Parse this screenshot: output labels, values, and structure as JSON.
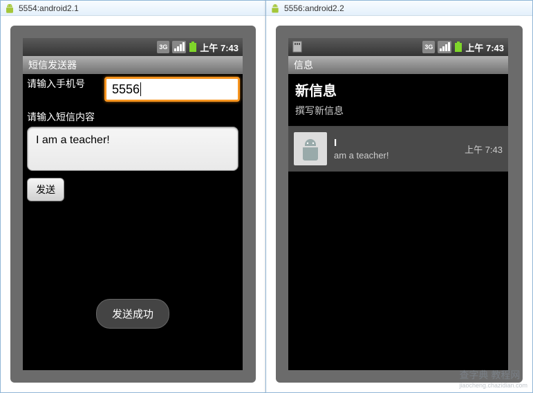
{
  "windows": {
    "left": {
      "title": "5554:android2.1"
    },
    "right": {
      "title": "5556:android2.2"
    }
  },
  "statusbar": {
    "time": "上午 7:43",
    "signal_3g": "3G",
    "signal_bars": "▮▮▮",
    "battery": "▮"
  },
  "sms_sender": {
    "app_title": "短信发送器",
    "phone_label": "请输入手机号",
    "phone_value": "5556",
    "content_label": "请输入短信内容",
    "content_value": "I am a teacher!",
    "send_button": "发送",
    "toast": "发送成功"
  },
  "messages_app": {
    "app_title": "信息",
    "new_message": "新信息",
    "compose": "撰写新信息",
    "items": [
      {
        "sender": "I",
        "preview": "am a teacher!",
        "time": "上午 7:43"
      }
    ]
  },
  "watermark": {
    "main": "查字典 教程网",
    "sub": "jiaocheng.chazidian.com"
  }
}
